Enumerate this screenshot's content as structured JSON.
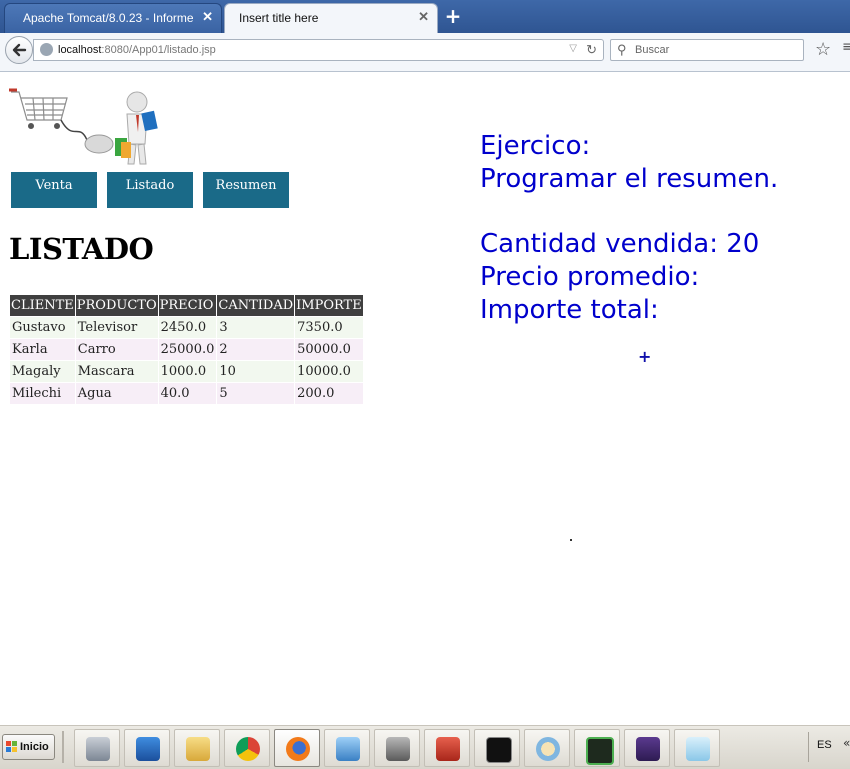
{
  "browser": {
    "tabs": [
      {
        "label": "Apache Tomcat/8.0.23 - Informe ...",
        "close": "✕"
      },
      {
        "label": "Insert title here",
        "close": "✕"
      }
    ],
    "new_tab": "+",
    "url_host": "localhost",
    "url_rest": ":8080/App01/listado.jsp",
    "search_placeholder": "Buscar"
  },
  "page": {
    "nav_buttons": [
      "Venta",
      "Listado",
      "Resumen"
    ],
    "heading": "LISTADO",
    "table": {
      "headers": [
        "CLIENTE",
        "PRODUCTO",
        "PRECIO",
        "CANTIDAD",
        "IMPORTE"
      ],
      "rows": [
        [
          "Gustavo",
          "Televisor",
          "2450.0",
          "3",
          "7350.0"
        ],
        [
          "Karla",
          "Carro",
          "25000.0",
          "2",
          "50000.0"
        ],
        [
          "Magaly",
          "Mascara",
          "1000.0",
          "10",
          "10000.0"
        ],
        [
          "Milechi",
          "Agua",
          "40.0",
          "5",
          "200.0"
        ]
      ]
    },
    "exercise": {
      "line1": "Ejercico:",
      "line2": "Programar el resumen.",
      "cantidad": "Cantidad vendida: 20",
      "precio": "Precio promedio:",
      "importe": "Importe total:"
    },
    "plus": "+"
  },
  "taskbar": {
    "start_label": "Inicio",
    "language": "ES",
    "icons": [
      "server-icon",
      "powershell-icon",
      "file-explorer-icon",
      "chrome-icon",
      "firefox-icon",
      "network-icon",
      "projector-icon",
      "toolbox-icon",
      "cmd-icon",
      "paint-icon",
      "terminal-icon",
      "java-ee-ide-icon",
      "notepad-icon"
    ]
  },
  "colors": {
    "nav_button_bg": "#1a6a88",
    "table_header_bg": "#3f3f3f",
    "row_odd": "#f2f8ef",
    "row_even": "#f7eef7",
    "exercise_text": "#0000cc"
  }
}
